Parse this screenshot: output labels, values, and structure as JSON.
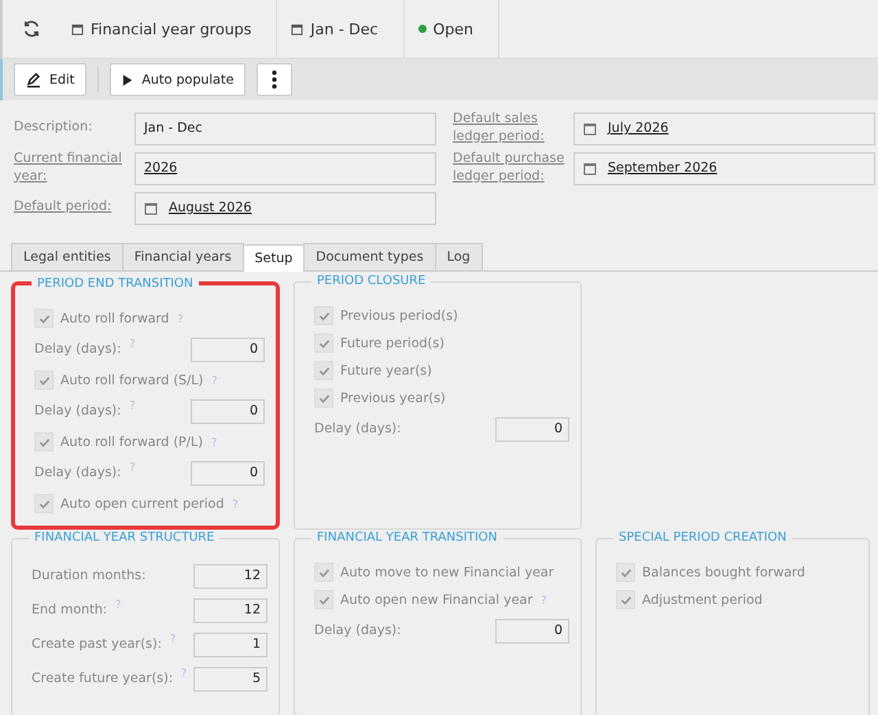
{
  "breadcrumbs": [
    {
      "kind": "calendar",
      "label": "Financial year groups"
    },
    {
      "kind": "calendar",
      "label": "Jan - Dec"
    },
    {
      "kind": "status",
      "label": "Open",
      "color": "#2ea043"
    }
  ],
  "toolbar": [
    {
      "kind": "edit",
      "label": "Edit"
    },
    {
      "kind": "play",
      "label": "Auto populate"
    },
    {
      "kind": "more"
    }
  ],
  "form": {
    "left": [
      {
        "label": "Description:",
        "value": "Jan - Dec",
        "linked": false,
        "date": false
      },
      {
        "label": "Current financial year:",
        "value": "2026",
        "linked": true,
        "date": false
      },
      {
        "label": "Default period:",
        "value": "August 2026",
        "linked": true,
        "date": true
      }
    ],
    "right": [
      {
        "label": "Default sales ledger period:",
        "value": "July 2026",
        "linked": true,
        "date": true
      },
      {
        "label": "Default purchase ledger period:",
        "value": "September 2026",
        "linked": true,
        "date": true
      }
    ]
  },
  "tabs": [
    {
      "label": "Legal entities",
      "selected": false
    },
    {
      "label": "Financial years",
      "selected": false
    },
    {
      "label": "Setup",
      "selected": true
    },
    {
      "label": "Document types",
      "selected": false
    },
    {
      "label": "Log",
      "selected": false
    }
  ],
  "group_rows": [
    [
      {
        "title": "PERIOD END TRANSITION",
        "highlighted": true,
        "rows": [
          {
            "kind": "check",
            "label": "Auto roll forward",
            "checked": true,
            "help": "?"
          },
          {
            "kind": "number",
            "label": "Delay (days):",
            "value": "0",
            "help": "?"
          },
          {
            "kind": "check",
            "label": "Auto roll forward (S/L)",
            "checked": true,
            "help": "?"
          },
          {
            "kind": "number",
            "label": "Delay (days):",
            "value": "0",
            "help": "?"
          },
          {
            "kind": "check",
            "label": "Auto roll forward (P/L)",
            "checked": true,
            "help": "?"
          },
          {
            "kind": "number",
            "label": "Delay (days):",
            "value": "0",
            "help": "?"
          },
          {
            "kind": "check",
            "label": "Auto open current period",
            "checked": true,
            "help": "?"
          }
        ]
      },
      {
        "title": "PERIOD CLOSURE",
        "highlighted": false,
        "rows": [
          {
            "kind": "check",
            "label": "Previous period(s)",
            "checked": true
          },
          {
            "kind": "check",
            "label": "Future period(s)",
            "checked": true
          },
          {
            "kind": "check",
            "label": "Future year(s)",
            "checked": true
          },
          {
            "kind": "check",
            "label": "Previous year(s)",
            "checked": true
          },
          {
            "kind": "number",
            "label": "Delay (days):",
            "value": "0"
          }
        ]
      }
    ],
    [
      {
        "title": "FINANCIAL YEAR STRUCTURE",
        "highlighted": false,
        "rows": [
          {
            "kind": "number",
            "label": "Duration months:",
            "value": "12"
          },
          {
            "kind": "number",
            "label": "End month:",
            "value": "12",
            "help": "?"
          },
          {
            "kind": "number",
            "label": "Create past year(s):",
            "value": "1",
            "help": "?"
          },
          {
            "kind": "number",
            "label": "Create future year(s):",
            "value": "5",
            "help": "?"
          }
        ]
      },
      {
        "title": "FINANCIAL YEAR TRANSITION",
        "highlighted": false,
        "rows": [
          {
            "kind": "check",
            "label": "Auto move to new Financial year",
            "checked": true
          },
          {
            "kind": "check",
            "label": "Auto open new Financial year",
            "checked": true,
            "help": "?"
          },
          {
            "kind": "number",
            "label": "Delay (days):",
            "value": "0"
          }
        ]
      },
      {
        "title": "SPECIAL PERIOD CREATION",
        "highlighted": false,
        "rows": [
          {
            "kind": "check",
            "label": "Balances bought forward",
            "checked": true
          },
          {
            "kind": "check",
            "label": "Adjustment period",
            "checked": true
          }
        ]
      }
    ]
  ]
}
